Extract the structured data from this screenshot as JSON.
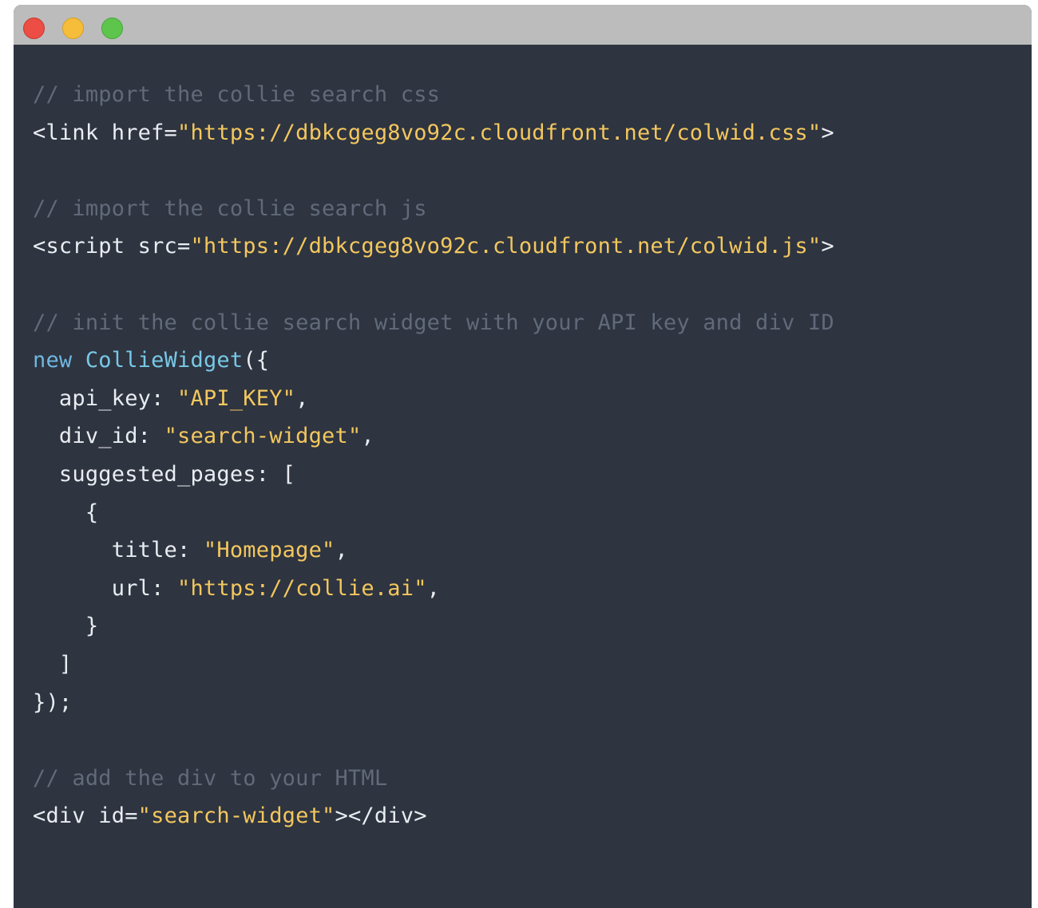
{
  "window": {
    "controls": {
      "close": "close-button",
      "minimize": "minimize-button",
      "zoom": "zoom-button"
    },
    "colors": {
      "titlebar": "#bcbcbc",
      "background": "#2e3440",
      "comment": "#616a79",
      "string": "#f3c75e",
      "keyword": "#6fb7e0",
      "text": "#e9ecf1"
    }
  },
  "code": {
    "line1_comment": "// import the collie search css",
    "line2_pre": "<link href=",
    "line2_str": "\"https://dbkcgeg8vo92c.cloudfront.net/colwid.css\"",
    "line2_post": ">",
    "line4_comment": "// import the collie search js",
    "line5_pre": "<script src=",
    "line5_str": "\"https://dbkcgeg8vo92c.cloudfront.net/colwid.js\"",
    "line5_post": ">",
    "line7_comment": "// init the collie search widget with your API key and div ID",
    "line8_kw": "new",
    "line8_cls": "CollieWidget",
    "line8_post": "({",
    "line9_key": "  api_key: ",
    "line9_str": "\"API_KEY\"",
    "line9_post": ",",
    "line10_key": "  div_id: ",
    "line10_str": "\"search-widget\"",
    "line10_post": ",",
    "line11": "  suggested_pages: [",
    "line12": "    {",
    "line13_key": "      title: ",
    "line13_str": "\"Homepage\"",
    "line13_post": ",",
    "line14_key": "      url: ",
    "line14_str": "\"https://collie.ai\"",
    "line14_post": ",",
    "line15": "    }",
    "line16": "  ]",
    "line17": "});",
    "line19_comment": "// add the div to your HTML",
    "line20_pre": "<div id=",
    "line20_str": "\"search-widget\"",
    "line20_post": "></div>"
  }
}
